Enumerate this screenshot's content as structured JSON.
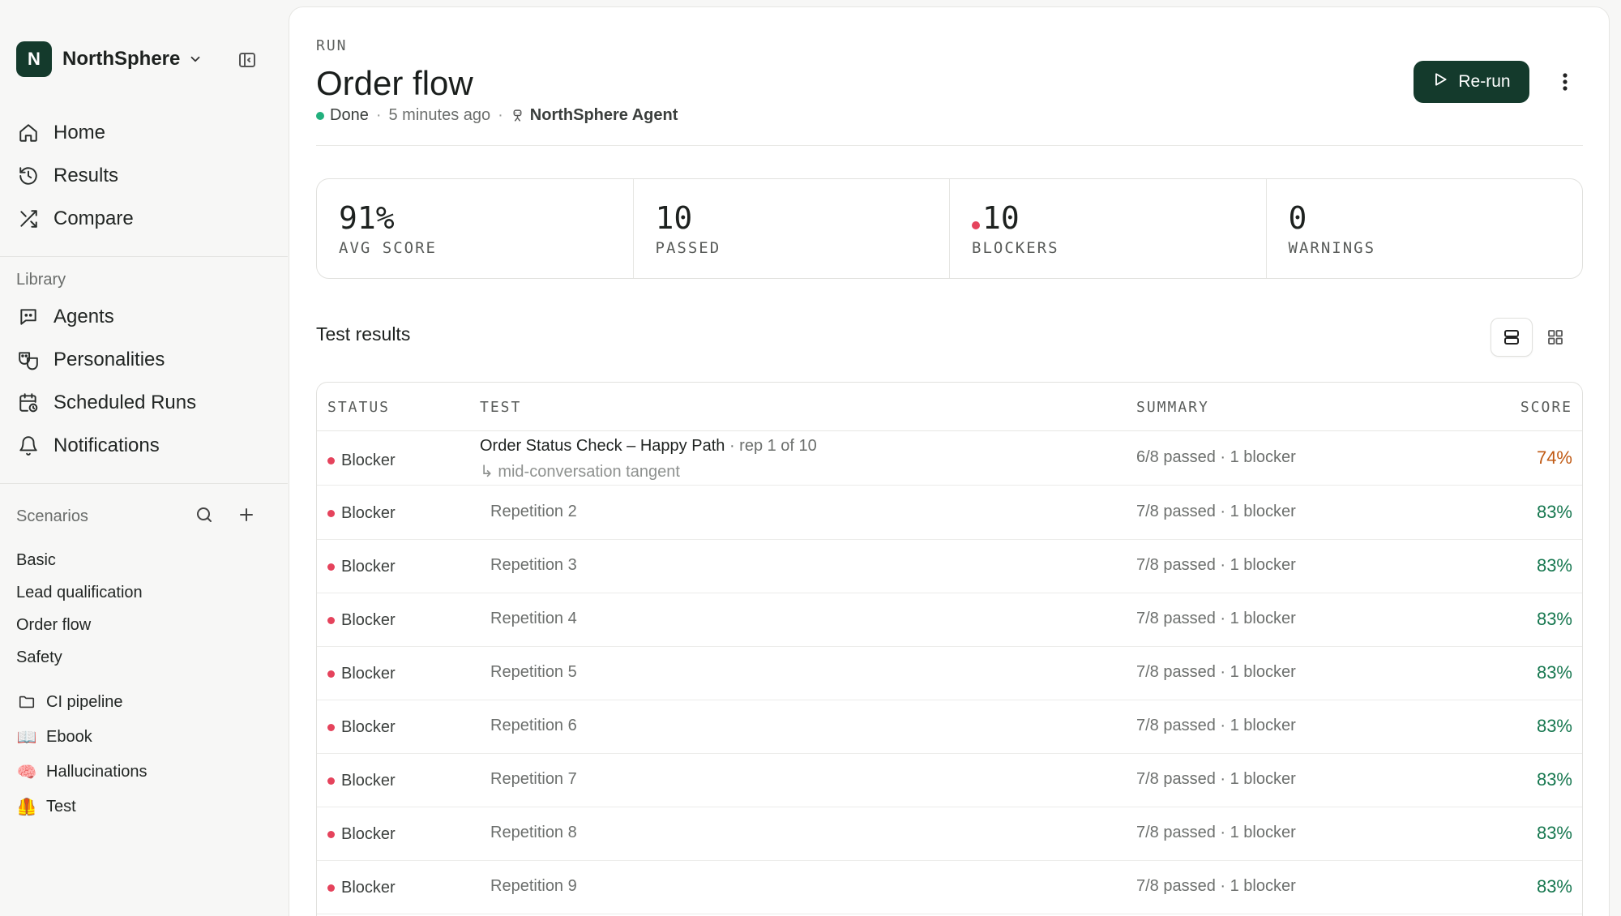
{
  "brand": {
    "initial": "N",
    "name": "NorthSphere"
  },
  "nav": [
    {
      "label": "Home",
      "icon": "home-icon"
    },
    {
      "label": "Results",
      "icon": "history-icon"
    },
    {
      "label": "Compare",
      "icon": "shuffle-icon"
    }
  ],
  "library": {
    "label": "Library",
    "items": [
      {
        "label": "Agents",
        "icon": "chat-bot-icon"
      },
      {
        "label": "Personalities",
        "icon": "masks-icon"
      },
      {
        "label": "Scheduled Runs",
        "icon": "calendar-clock-icon"
      },
      {
        "label": "Notifications",
        "icon": "bell-icon"
      }
    ]
  },
  "scenarios": {
    "label": "Scenarios",
    "items": [
      "Basic",
      "Lead qualification",
      "Order flow",
      "Safety"
    ],
    "folders": [
      {
        "label": "CI pipeline",
        "icon": "folder-icon"
      },
      {
        "label": "Ebook",
        "icon": "📖"
      },
      {
        "label": "Hallucinations",
        "icon": "🧠"
      },
      {
        "label": "Test",
        "icon": "🦺"
      }
    ]
  },
  "run": {
    "kicker": "RUN",
    "title": "Order flow",
    "status": "Done",
    "time": "5 minutes ago",
    "agent": "NorthSphere Agent",
    "rerun_label": "Re-run"
  },
  "stats": [
    {
      "value": "91%",
      "label": "AVG SCORE"
    },
    {
      "value": "10",
      "label": "PASSED"
    },
    {
      "value": "10",
      "label": "BLOCKERS"
    },
    {
      "value": "0",
      "label": "WARNINGS"
    }
  ],
  "results": {
    "title": "Test results",
    "columns": {
      "status": "STATUS",
      "test": "TEST",
      "summary": "SUMMARY",
      "score": "SCORE"
    },
    "first_row": {
      "status": "Blocker",
      "test": "Order Status Check – Happy Path",
      "rep": "· rep 1 of 10",
      "sub": "↳ mid-conversation tangent",
      "summary": "6/8 passed · 1 blocker",
      "score": "74%"
    },
    "rows": [
      {
        "status": "Blocker",
        "test": "Repetition 2",
        "summary": "7/8 passed · 1 blocker",
        "score": "83%"
      },
      {
        "status": "Blocker",
        "test": "Repetition 3",
        "summary": "7/8 passed · 1 blocker",
        "score": "83%"
      },
      {
        "status": "Blocker",
        "test": "Repetition 4",
        "summary": "7/8 passed · 1 blocker",
        "score": "83%"
      },
      {
        "status": "Blocker",
        "test": "Repetition 5",
        "summary": "7/8 passed · 1 blocker",
        "score": "83%"
      },
      {
        "status": "Blocker",
        "test": "Repetition 6",
        "summary": "7/8 passed · 1 blocker",
        "score": "83%"
      },
      {
        "status": "Blocker",
        "test": "Repetition 7",
        "summary": "7/8 passed · 1 blocker",
        "score": "83%"
      },
      {
        "status": "Blocker",
        "test": "Repetition 8",
        "summary": "7/8 passed · 1 blocker",
        "score": "83%"
      },
      {
        "status": "Blocker",
        "test": "Repetition 9",
        "summary": "7/8 passed · 1 blocker",
        "score": "83%"
      }
    ]
  },
  "colors": {
    "brand": "#143a2c",
    "blocker": "#e5435c",
    "done": "#22b07d",
    "score_low": "#c05a14",
    "score_ok": "#16774f"
  }
}
